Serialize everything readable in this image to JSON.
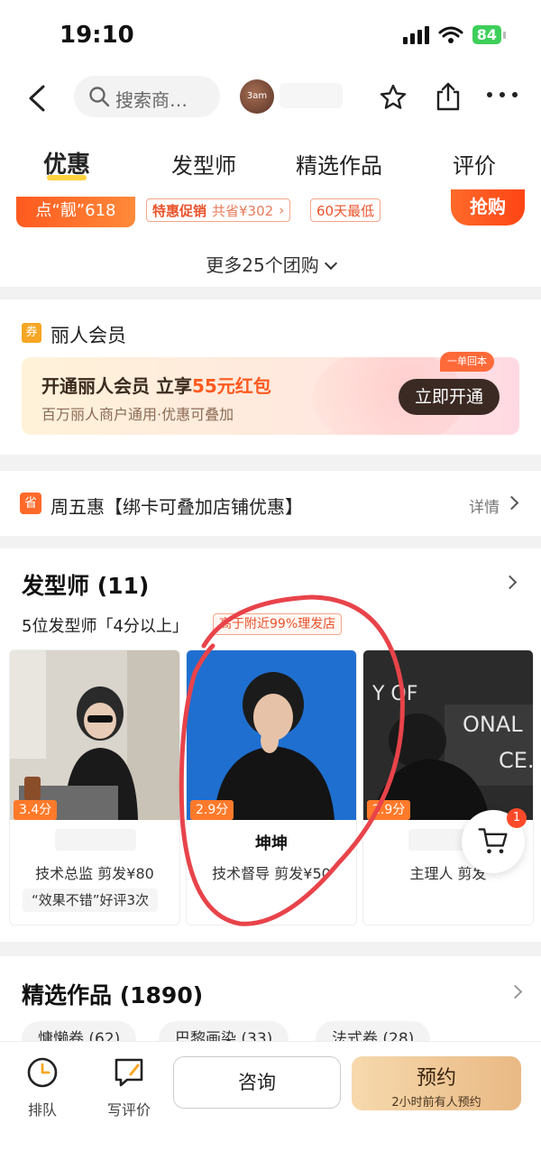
{
  "status_bar": {
    "time": "19:10",
    "battery": "84"
  },
  "nav": {
    "search_placeholder": "搜索商…",
    "shop_logo_text": "3am"
  },
  "tabs": [
    "优惠",
    "发型师",
    "精选作品",
    "评价"
  ],
  "deals": {
    "promo_label": "点“靓”618",
    "tag1_a": "特惠促销",
    "tag1_b": "共省¥302",
    "tag2": "60天最低",
    "buy_label": "抢购",
    "more_deals": "更多25个团购"
  },
  "member": {
    "icon_text": "券",
    "title": "丽人会员",
    "line1_prefix": "开通丽人会员 立享",
    "line1_highlight": "55元红包",
    "line2": "百万丽人商户通用·优惠可叠加",
    "badge": "一单回本",
    "open_button": "立即开通"
  },
  "friday": {
    "icon_text": "省",
    "text": "周五惠【绑卡可叠加店铺优惠】",
    "detail": "详情"
  },
  "stylists": {
    "title": "发型师 (11)",
    "subtitle": "5位发型师「4分以上」",
    "tag": "高于附近99%理发店",
    "cards": [
      {
        "score": "3.4分",
        "name": "",
        "role": "技术总监  剪发¥80",
        "review": "“效果不错”好评3次"
      },
      {
        "score": "2.9分",
        "name": "坤坤",
        "role": "技术督导  剪发¥50",
        "review": ""
      },
      {
        "score": "2.9分",
        "name": "",
        "role": "主理人  剪发",
        "review": ""
      }
    ],
    "cart_count": "1"
  },
  "works": {
    "title": "精选作品 (1890)",
    "chips": [
      "慵懒卷 (62)",
      "巴黎画染 (33)",
      "法式卷 (28)"
    ]
  },
  "bottom": {
    "queue": "排队",
    "review": "写评价",
    "consult": "咨询",
    "book": "预约",
    "book_sub": "2小时前有人预约"
  },
  "colors": {
    "accent": "#ff5a1f",
    "tab_underline": "#ffd23f",
    "book_gradient_start": "#f6d9ad",
    "annotation_circle": "#e8434a"
  }
}
